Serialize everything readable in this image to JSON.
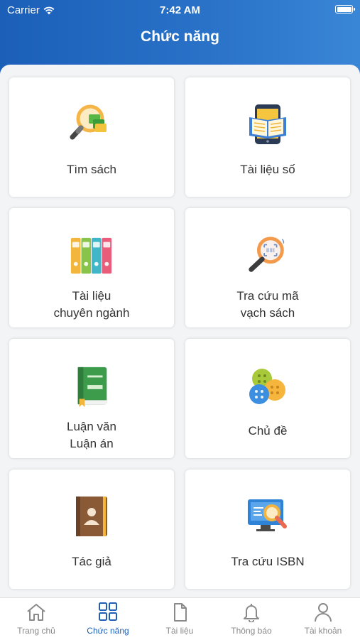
{
  "status_bar": {
    "carrier": "Carrier",
    "time": "7:42 AM"
  },
  "header": {
    "title": "Chức năng"
  },
  "cards": [
    {
      "id": "tim-sach",
      "lines": [
        "Tìm sách"
      ],
      "icon": "search-books-icon"
    },
    {
      "id": "tai-lieu-so",
      "lines": [
        "Tài liệu số"
      ],
      "icon": "ebook-icon"
    },
    {
      "id": "tai-lieu-chuyen-nganh",
      "lines": [
        "Tài liệu",
        "chuyên ngành"
      ],
      "icon": "binders-icon"
    },
    {
      "id": "tra-cuu-ma-vach",
      "lines": [
        "Tra cứu mã",
        "vạch sách"
      ],
      "icon": "barcode-search-icon"
    },
    {
      "id": "luan-van",
      "lines": [
        "Luận văn",
        "Luận án"
      ],
      "icon": "thesis-book-icon"
    },
    {
      "id": "chu-de",
      "lines": [
        "Chủ đề"
      ],
      "icon": "topics-buttons-icon"
    },
    {
      "id": "tac-gia",
      "lines": [
        "Tác giả"
      ],
      "icon": "author-book-icon"
    },
    {
      "id": "tra-cuu-isbn",
      "lines": [
        "Tra cứu ISBN"
      ],
      "icon": "isbn-search-icon"
    }
  ],
  "tabs": [
    {
      "label": "Trang chủ",
      "icon": "home-icon",
      "active": false
    },
    {
      "label": "Chức năng",
      "icon": "grid-icon",
      "active": true
    },
    {
      "label": "Tài liệu",
      "icon": "document-icon",
      "active": false
    },
    {
      "label": "Thông báo",
      "icon": "bell-icon",
      "active": false
    },
    {
      "label": "Tài khoản",
      "icon": "user-icon",
      "active": false
    }
  ],
  "colors": {
    "header": "#1f63bc",
    "active_tab": "#1f5fb5",
    "inactive_tab": "#8a8a8a"
  }
}
